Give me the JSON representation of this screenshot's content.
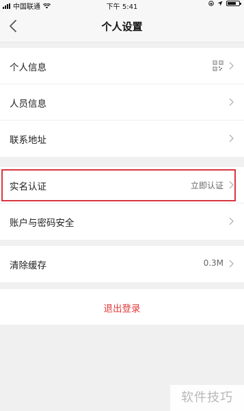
{
  "status_bar": {
    "carrier": "中国联通",
    "time": "下午 5:41"
  },
  "nav": {
    "title": "个人设置"
  },
  "groups": [
    {
      "items": [
        {
          "label": "个人信息",
          "icon": "qr-code-icon"
        },
        {
          "label": "人员信息"
        },
        {
          "label": "联系地址"
        }
      ]
    },
    {
      "items": [
        {
          "label": "实名认证",
          "value": "立即认证"
        },
        {
          "label": "账户与密码安全"
        }
      ]
    },
    {
      "items": [
        {
          "label": "清除缓存",
          "value": "0.3M"
        }
      ]
    }
  ],
  "logout_label": "退出登录",
  "watermark": "软件技巧",
  "colors": {
    "highlight": "#d9363e",
    "logout_text": "#e23b3b",
    "background": "#f0f0f0"
  }
}
